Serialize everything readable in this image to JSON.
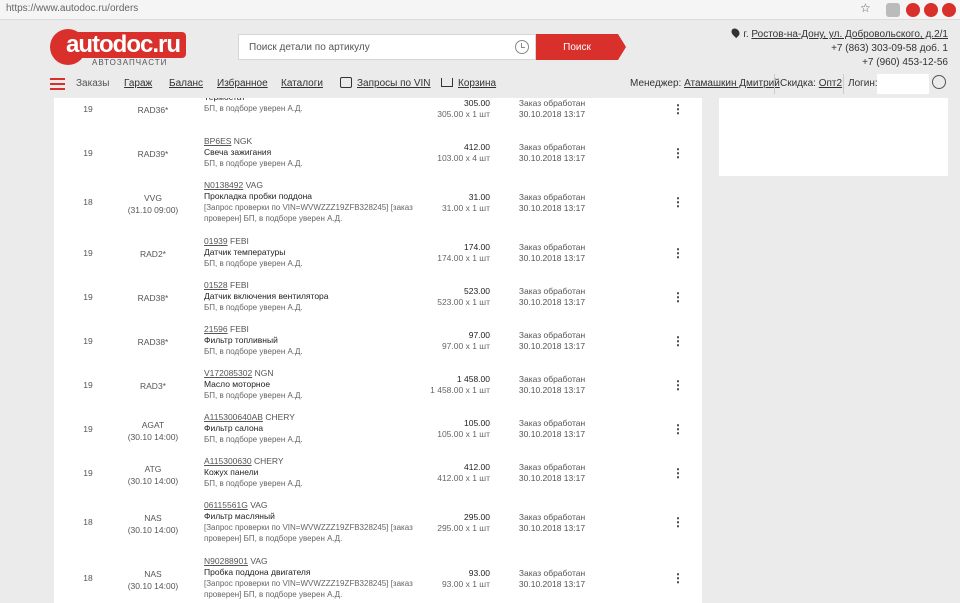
{
  "browser": {
    "url": "https://www.autodoc.ru/orders"
  },
  "logo": {
    "text": "autodoc.ru",
    "sub": "АВТОЗАПЧАСТИ"
  },
  "search": {
    "placeholder": "Поиск детали по артикулу",
    "button": "Поиск"
  },
  "contacts": {
    "location_prefix": "г.",
    "location_link": "Ростов-на-Дону, ул. Добровольского, д.2/1",
    "phone1": "+7 (863) 303-09-58 доб. 1",
    "phone2": "+7 (960) 453-12-56"
  },
  "nav": {
    "orders": "Заказы",
    "garage": "Гараж",
    "balance": "Баланс",
    "favorites": "Избранное",
    "catalogs": "Каталоги",
    "vin": "Запросы по VIN",
    "cart": "Корзина",
    "manager_label": "Менеджер:",
    "manager_name": "Атамашкин Дмитрий",
    "discount_label": "Скидка:",
    "discount_value": "Опт2",
    "login_label": "Логин:"
  },
  "rows": [
    {
      "qty": "19",
      "code": "RAD36*",
      "code2": "",
      "article": "",
      "brand": "",
      "name": "Термостат",
      "note": "БП, в подборе уверен А.Д.",
      "note2": "",
      "price": "305.00",
      "price_calc": "305.00 x 1 шт",
      "status": "Заказ обработан",
      "date": "30.10.2018 13:17"
    },
    {
      "qty": "19",
      "code": "RAD39*",
      "code2": "",
      "article": "BP6ES",
      "brand": "NGK",
      "name": "Свеча зажигания",
      "note": "БП, в подборе уверен А.Д.",
      "note2": "",
      "price": "412.00",
      "price_calc": "103.00 x 4 шт",
      "status": "Заказ обработан",
      "date": "30.10.2018 13:17"
    },
    {
      "qty": "18",
      "code": "VVG",
      "code2": "(31.10 09:00)",
      "article": "N0138492",
      "brand": "VAG",
      "name": "Прокладка пробки поддона",
      "note": "[Запрос проверки по VIN=WVWZZZ19ZFB328245] [заказ",
      "note2": "проверен] БП, в подборе уверен А.Д.",
      "price": "31.00",
      "price_calc": "31.00 x 1 шт",
      "status": "Заказ обработан",
      "date": "30.10.2018 13:17"
    },
    {
      "qty": "19",
      "code": "RAD2*",
      "code2": "",
      "article": "01939",
      "brand": "FEBI",
      "name": "Датчик температуры",
      "note": "БП, в подборе уверен А.Д.",
      "note2": "",
      "price": "174.00",
      "price_calc": "174.00 x 1 шт",
      "status": "Заказ обработан",
      "date": "30.10.2018 13:17"
    },
    {
      "qty": "19",
      "code": "RAD38*",
      "code2": "",
      "article": "01528",
      "brand": "FEBI",
      "name": "Датчик включения вентилятора",
      "note": "БП, в подборе уверен А.Д.",
      "note2": "",
      "price": "523.00",
      "price_calc": "523.00 x 1 шт",
      "status": "Заказ обработан",
      "date": "30.10.2018 13:17"
    },
    {
      "qty": "19",
      "code": "RAD38*",
      "code2": "",
      "article": "21596",
      "brand": "FEBI",
      "name": "Фильтр топливный",
      "note": "БП, в подборе уверен А.Д.",
      "note2": "",
      "price": "97.00",
      "price_calc": "97.00 x 1 шт",
      "status": "Заказ обработан",
      "date": "30.10.2018 13:17"
    },
    {
      "qty": "19",
      "code": "RAD3*",
      "code2": "",
      "article": "V172085302",
      "brand": "NGN",
      "name": "Масло моторное",
      "note": "БП, в подборе уверен А.Д.",
      "note2": "",
      "price": "1 458.00",
      "price_calc": "1 458.00 x 1 шт",
      "status": "Заказ обработан",
      "date": "30.10.2018 13:17"
    },
    {
      "qty": "19",
      "code": "AGAT",
      "code2": "(30.10 14:00)",
      "article": "A115300640AB",
      "brand": "CHERY",
      "name": "Фильтр салона",
      "note": "БП, в подборе уверен А.Д.",
      "note2": "",
      "price": "105.00",
      "price_calc": "105.00 x 1 шт",
      "status": "Заказ обработан",
      "date": "30.10.2018 13:17"
    },
    {
      "qty": "19",
      "code": "ATG",
      "code2": "(30.10 14:00)",
      "article": "A115300630",
      "brand": "CHERY",
      "name": "Кожух панели",
      "note": "БП, в подборе уверен А.Д.",
      "note2": "",
      "price": "412.00",
      "price_calc": "412.00 x 1 шт",
      "status": "Заказ обработан",
      "date": "30.10.2018 13:17"
    },
    {
      "qty": "18",
      "code": "NAS",
      "code2": "(30.10 14:00)",
      "article": "06115561G",
      "brand": "VAG",
      "name": "Фильтр масляный",
      "note": "[Запрос проверки по VIN=WVWZZZ19ZFB328245] [заказ",
      "note2": "проверен] БП, в подборе уверен А.Д.",
      "price": "295.00",
      "price_calc": "295.00 x 1 шт",
      "status": "Заказ обработан",
      "date": "30.10.2018 13:17"
    },
    {
      "qty": "18",
      "code": "NAS",
      "code2": "(30.10 14:00)",
      "article": "N90288901",
      "brand": "VAG",
      "name": "Пробка поддона двигателя",
      "note": "[Запрос проверки по VIN=WVWZZZ19ZFB328245] [заказ",
      "note2": "проверен] БП, в подборе уверен А.Д.",
      "price": "93.00",
      "price_calc": "93.00 x 1 шт",
      "status": "Заказ обработан",
      "date": "30.10.2018 13:17"
    }
  ]
}
